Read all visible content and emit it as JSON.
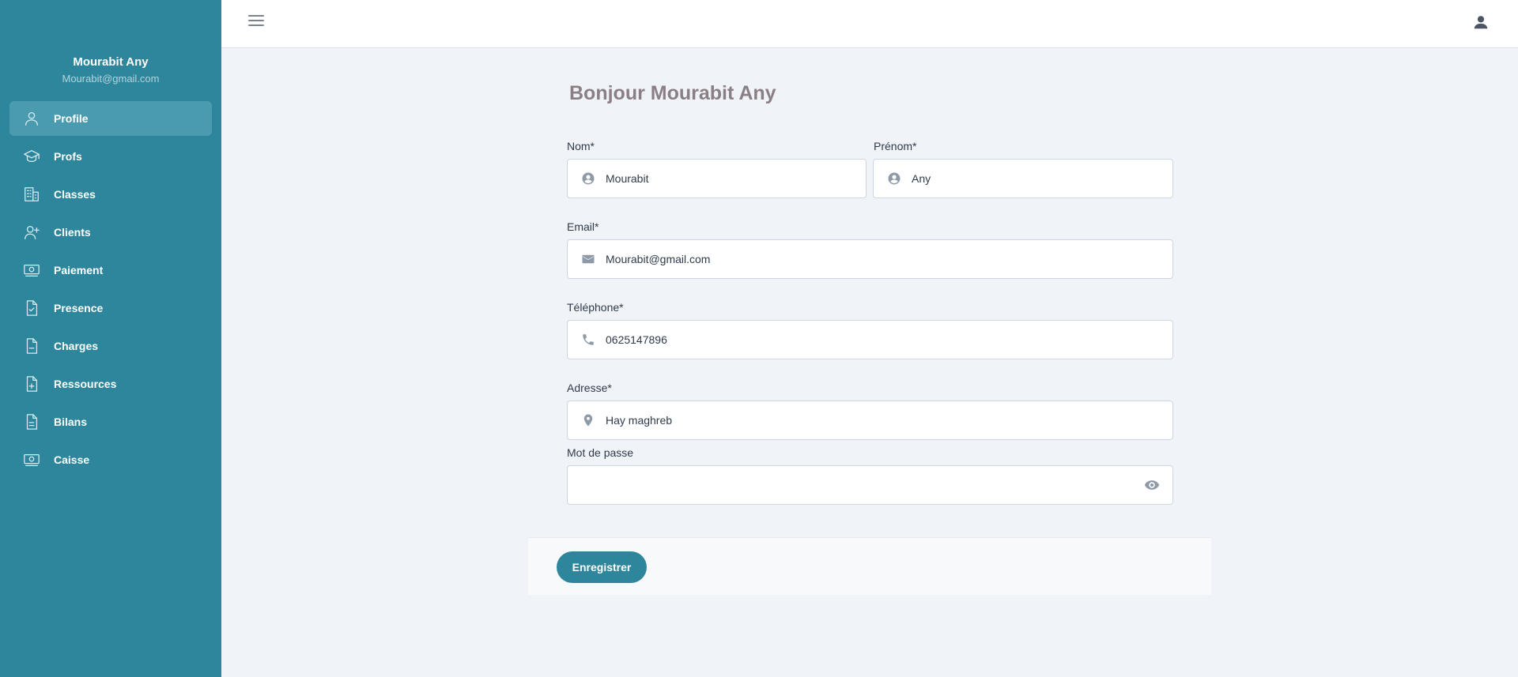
{
  "user": {
    "name": "Mourabit Any",
    "email": "Mourabit@gmail.com"
  },
  "sidebar": {
    "items": [
      {
        "label": "Profile",
        "icon": "user-icon",
        "active": true
      },
      {
        "label": "Profs",
        "icon": "graduation-cap-icon",
        "active": false
      },
      {
        "label": "Classes",
        "icon": "building-icon",
        "active": false
      },
      {
        "label": "Clients",
        "icon": "user-plus-icon",
        "active": false
      },
      {
        "label": "Paiement",
        "icon": "money-icon",
        "active": false
      },
      {
        "label": "Presence",
        "icon": "document-check-icon",
        "active": false
      },
      {
        "label": "Charges",
        "icon": "document-minus-icon",
        "active": false
      },
      {
        "label": "Ressources",
        "icon": "document-plus-icon",
        "active": false
      },
      {
        "label": "Bilans",
        "icon": "document-text-icon",
        "active": false
      },
      {
        "label": "Caisse",
        "icon": "money-icon",
        "active": false
      }
    ]
  },
  "topbar": {
    "menu_icon": "hamburger-icon",
    "profile_icon": "account-icon"
  },
  "form": {
    "greeting": "Bonjour Mourabit Any",
    "nom": {
      "label": "Nom*",
      "value": "Mourabit",
      "icon": "account-circle-icon"
    },
    "prenom": {
      "label": "Prénom*",
      "value": "Any",
      "icon": "account-circle-icon"
    },
    "email": {
      "label": "Email*",
      "value": "Mourabit@gmail.com",
      "icon": "envelope-icon"
    },
    "telephone": {
      "label": "Téléphone*",
      "value": "0625147896",
      "icon": "phone-icon"
    },
    "adresse": {
      "label": "Adresse*",
      "value": "Hay maghreb",
      "icon": "map-pin-icon"
    },
    "password": {
      "label": "Mot de passe",
      "value": "",
      "icon": "eye-icon"
    },
    "save_label": "Enregistrer"
  },
  "colors": {
    "sidebar_bg": "#2e869d",
    "active_item_bg": "#4b9bb0",
    "page_bg": "#f0f3f7",
    "button_bg": "#2e869d",
    "greeting_text": "#8a7f84"
  }
}
